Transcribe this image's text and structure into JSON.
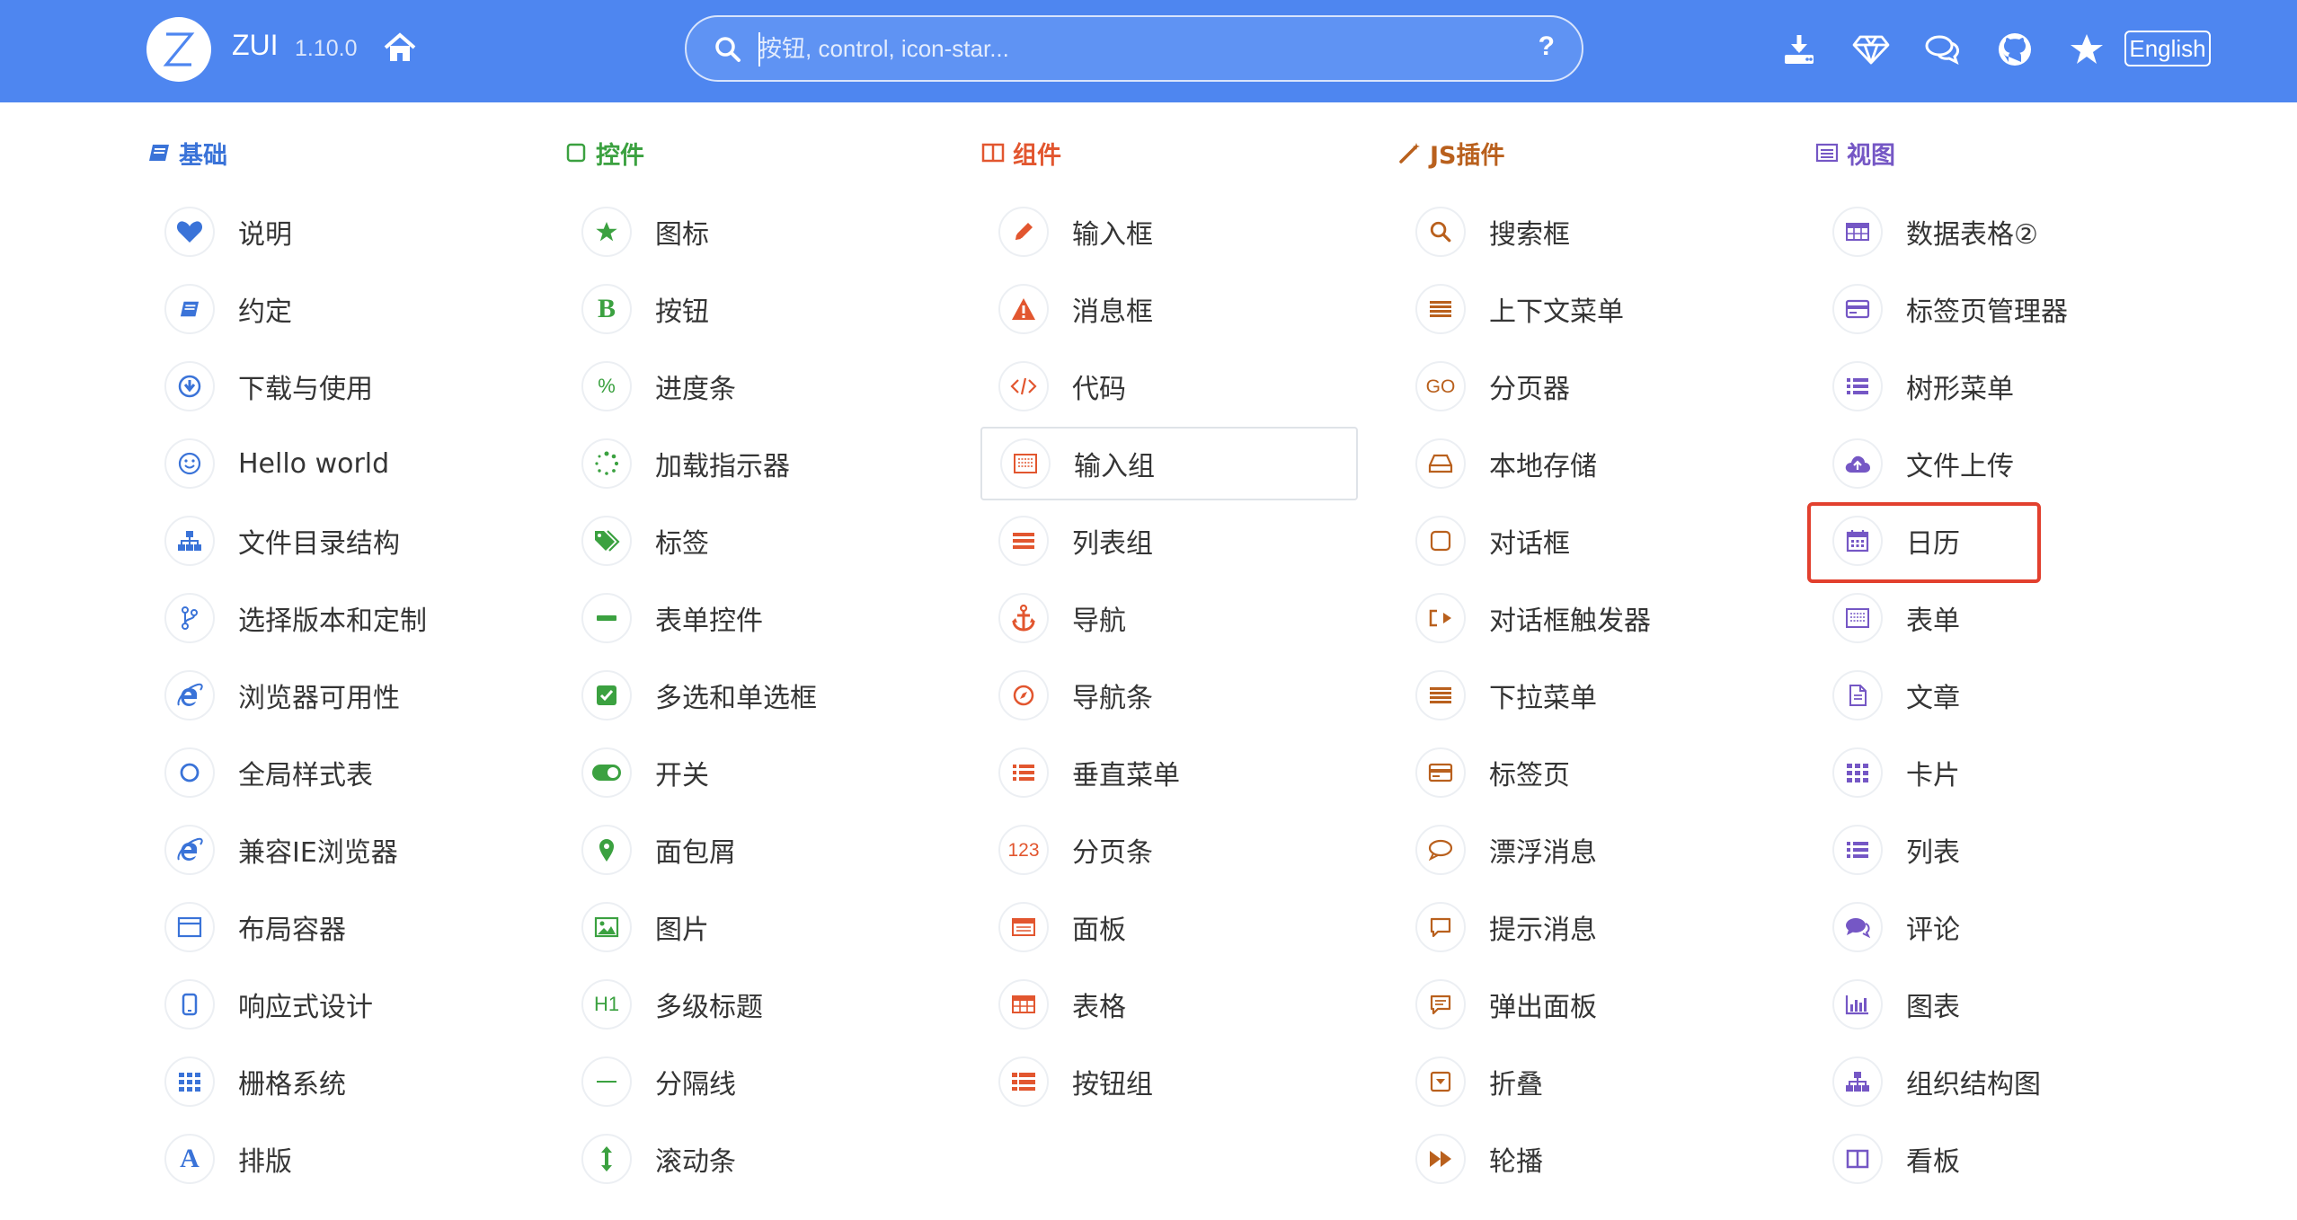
{
  "header": {
    "brand": "ZUI",
    "version": "1.10.0",
    "search_placeholder": "按钮, control, icon-star...",
    "help": "?",
    "language": "English"
  },
  "colors": {
    "header_bg": "#4e86f0",
    "basic": "#3a73d8",
    "controls": "#3ba140",
    "components": "#e2562f",
    "js_plugins": "#b9601d",
    "views": "#7557c5",
    "highlight": "#e2402e"
  },
  "columns": [
    {
      "title": "基础",
      "icon": "book-icon",
      "color": "#3a73d8",
      "items": [
        {
          "label": "说明",
          "icon": "heart-icon"
        },
        {
          "label": "约定",
          "icon": "book-icon"
        },
        {
          "label": "下载与使用",
          "icon": "download-circle-icon"
        },
        {
          "label": "Hello world",
          "icon": "smile-icon"
        },
        {
          "label": "文件目录结构",
          "icon": "sitemap-icon"
        },
        {
          "label": "选择版本和定制",
          "icon": "branch-icon"
        },
        {
          "label": "浏览器可用性",
          "icon": "ie-icon"
        },
        {
          "label": "全局样式表",
          "icon": "circle-outline-icon"
        },
        {
          "label": "兼容IE浏览器",
          "icon": "ie-icon"
        },
        {
          "label": "布局容器",
          "icon": "window-icon"
        },
        {
          "label": "响应式设计",
          "icon": "mobile-icon"
        },
        {
          "label": "栅格系统",
          "icon": "grid-icon"
        },
        {
          "label": "排版",
          "icon": "font-icon"
        }
      ]
    },
    {
      "title": "控件",
      "icon": "square-outline-icon",
      "color": "#3ba140",
      "items": [
        {
          "label": "图标",
          "icon": "star-icon"
        },
        {
          "label": "按钮",
          "icon": "bold-b-icon"
        },
        {
          "label": "进度条",
          "icon": "percent-icon"
        },
        {
          "label": "加载指示器",
          "icon": "spinner-icon"
        },
        {
          "label": "标签",
          "icon": "tags-icon"
        },
        {
          "label": "表单控件",
          "icon": "minus-icon"
        },
        {
          "label": "多选和单选框",
          "icon": "checkbox-icon"
        },
        {
          "label": "开关",
          "icon": "toggle-icon"
        },
        {
          "label": "面包屑",
          "icon": "map-marker-icon"
        },
        {
          "label": "图片",
          "icon": "picture-icon"
        },
        {
          "label": "多级标题",
          "icon": "h1-icon"
        },
        {
          "label": "分隔线",
          "icon": "divider-icon"
        },
        {
          "label": "滚动条",
          "icon": "vertical-arrows-icon"
        }
      ]
    },
    {
      "title": "组件",
      "icon": "columns-icon",
      "color": "#e2562f",
      "items": [
        {
          "label": "输入框",
          "icon": "pencil-icon"
        },
        {
          "label": "消息框",
          "icon": "warning-icon"
        },
        {
          "label": "代码",
          "icon": "code-icon"
        },
        {
          "label": "输入组",
          "icon": "input-group-icon",
          "hovered": true
        },
        {
          "label": "列表组",
          "icon": "list-icon"
        },
        {
          "label": "导航",
          "icon": "anchor-icon"
        },
        {
          "label": "导航条",
          "icon": "compass-icon"
        },
        {
          "label": "垂直菜单",
          "icon": "list-ul-icon"
        },
        {
          "label": "分页条",
          "icon": "numbers-icon"
        },
        {
          "label": "面板",
          "icon": "panel-icon"
        },
        {
          "label": "表格",
          "icon": "table-icon"
        },
        {
          "label": "按钮组",
          "icon": "button-group-icon"
        }
      ]
    },
    {
      "title": "JS插件",
      "icon": "magic-wand-icon",
      "color": "#b9601d",
      "items": [
        {
          "label": "搜索框",
          "icon": "search-icon"
        },
        {
          "label": "上下文菜单",
          "icon": "menu-lines-icon"
        },
        {
          "label": "分页器",
          "icon": "go-icon"
        },
        {
          "label": "本地存储",
          "icon": "drive-icon"
        },
        {
          "label": "对话框",
          "icon": "dialog-square-icon"
        },
        {
          "label": "对话框触发器",
          "icon": "share-icon"
        },
        {
          "label": "下拉菜单",
          "icon": "menu-lines-icon"
        },
        {
          "label": "标签页",
          "icon": "card-icon"
        },
        {
          "label": "漂浮消息",
          "icon": "chat-bubble-icon"
        },
        {
          "label": "提示消息",
          "icon": "comment-icon"
        },
        {
          "label": "弹出面板",
          "icon": "popover-icon"
        },
        {
          "label": "折叠",
          "icon": "collapse-icon"
        },
        {
          "label": "轮播",
          "icon": "fast-forward-icon"
        }
      ]
    },
    {
      "title": "视图",
      "icon": "list-view-icon",
      "color": "#7557c5",
      "items": [
        {
          "label": "数据表格②",
          "icon": "table-icon"
        },
        {
          "label": "标签页管理器",
          "icon": "card-icon"
        },
        {
          "label": "树形菜单",
          "icon": "list-icon"
        },
        {
          "label": "文件上传",
          "icon": "cloud-upload-icon"
        },
        {
          "label": "日历",
          "icon": "calendar-icon",
          "highlighted": true
        },
        {
          "label": "表单",
          "icon": "form-icon"
        },
        {
          "label": "文章",
          "icon": "document-icon"
        },
        {
          "label": "卡片",
          "icon": "grid-icon"
        },
        {
          "label": "列表",
          "icon": "list-ul-icon"
        },
        {
          "label": "评论",
          "icon": "comments-icon"
        },
        {
          "label": "图表",
          "icon": "bar-chart-icon"
        },
        {
          "label": "组织结构图",
          "icon": "sitemap-icon"
        },
        {
          "label": "看板",
          "icon": "columns-icon"
        }
      ]
    }
  ]
}
